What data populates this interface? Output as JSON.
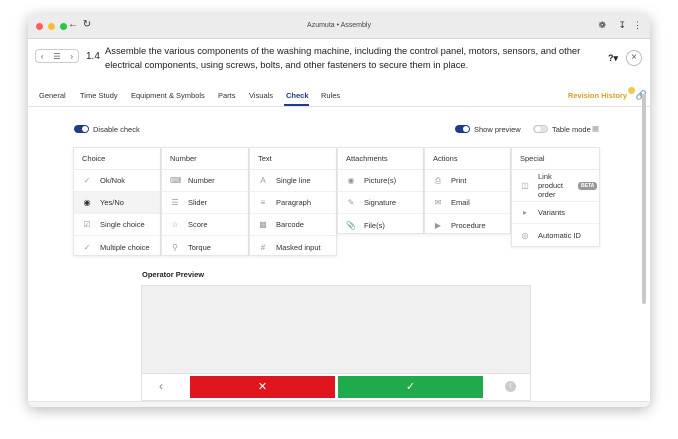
{
  "window": {
    "title": "Azumuta • Assembly"
  },
  "colors": {
    "accent": "#1f3b8a",
    "revision": "#d4a02a",
    "no": "#e0161f",
    "yes": "#1faa4c"
  },
  "step": {
    "number": "1.4",
    "title": "Assemble the various components of the washing machine, including the control panel, motors, sensors, and other electrical components, using screws, bolts, and other fasteners to secure them in place."
  },
  "tabs": [
    "General",
    "Time Study",
    "Equipment & Symbols",
    "Parts",
    "Visuals",
    "Check",
    "Rules"
  ],
  "active_tab": "Check",
  "revision_history": "Revision History",
  "toggles": {
    "disable_check": {
      "label": "Disable check",
      "on": true
    },
    "show_preview": {
      "label": "Show preview",
      "on": true
    },
    "table_mode": {
      "label": "Table mode",
      "on": false
    }
  },
  "columns": [
    {
      "title": "Choice",
      "items": [
        {
          "label": "Ok/Nok",
          "icon": "check-icon"
        },
        {
          "label": "Yes/No",
          "icon": "check-circle-icon",
          "selected": true
        },
        {
          "label": "Single choice",
          "icon": "checkbox-icon"
        },
        {
          "label": "Multiple choice",
          "icon": "multi-check-icon"
        }
      ]
    },
    {
      "title": "Number",
      "items": [
        {
          "label": "Number",
          "icon": "number-icon"
        },
        {
          "label": "Slider",
          "icon": "slider-icon"
        },
        {
          "label": "Score",
          "icon": "star-icon"
        },
        {
          "label": "Torque",
          "icon": "wrench-icon"
        }
      ]
    },
    {
      "title": "Text",
      "items": [
        {
          "label": "Single line",
          "icon": "text-icon"
        },
        {
          "label": "Paragraph",
          "icon": "paragraph-icon"
        },
        {
          "label": "Barcode",
          "icon": "barcode-icon"
        },
        {
          "label": "Masked input",
          "icon": "hash-icon"
        }
      ]
    },
    {
      "title": "Attachments",
      "items": [
        {
          "label": "Picture(s)",
          "icon": "camera-icon"
        },
        {
          "label": "Signature",
          "icon": "signature-icon"
        },
        {
          "label": "File(s)",
          "icon": "paperclip-icon"
        }
      ]
    },
    {
      "title": "Actions",
      "items": [
        {
          "label": "Print",
          "icon": "printer-icon"
        },
        {
          "label": "Email",
          "icon": "mail-icon"
        },
        {
          "label": "Procedure",
          "icon": "play-icon"
        }
      ]
    },
    {
      "title": "Special",
      "items": [
        {
          "label": "Link product order",
          "icon": "link-order-icon",
          "badge": "BETA"
        },
        {
          "label": "Variants",
          "icon": "tag-icon"
        },
        {
          "label": "Automatic ID",
          "icon": "fingerprint-icon"
        }
      ]
    }
  ],
  "preview": {
    "title": "Operator Preview"
  }
}
